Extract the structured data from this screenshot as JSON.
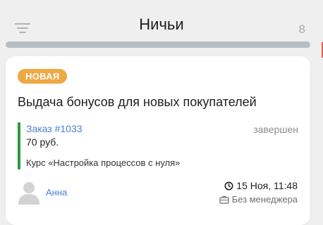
{
  "column": {
    "title": "Ничьи",
    "count": "8",
    "progress": 1.0,
    "colors": {
      "track": "#d4d4d4",
      "fill": "#b6bec6"
    }
  },
  "card": {
    "badge": {
      "label": "НОВАЯ",
      "color": "#eea844"
    },
    "title": "Выдача бонусов для новых покупателей",
    "order": {
      "link": "Заказ #1033",
      "status": "завершен",
      "price": "70 руб.",
      "course": "Курс «Настройка процессов с нуля»",
      "accent_color": "#2e9a3e"
    },
    "user": {
      "name": "Анна",
      "avatar_icon": "user-avatar-icon"
    },
    "date": {
      "icon": "clock-icon",
      "text": "15 Ноя, 11:48"
    },
    "manager": {
      "icon": "briefcase-icon",
      "text": "Без менеджера"
    }
  }
}
